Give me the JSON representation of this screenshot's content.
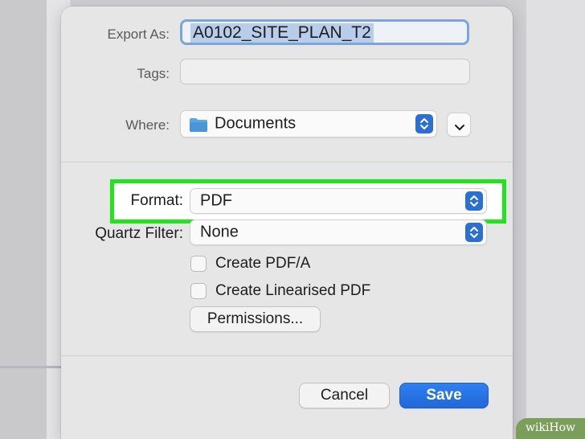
{
  "dialog": {
    "export_as_label": "Export As:",
    "export_as_value": "A0102_SITE_PLAN_T2",
    "tags_label": "Tags:",
    "tags_value": "",
    "where_label": "Where:",
    "where_value": "Documents",
    "where_icon": "folder-icon",
    "format_label": "Format:",
    "format_value": "PDF",
    "quartz_label": "Quartz Filter:",
    "quartz_value": "None",
    "create_pdfa_label": "Create PDF/A",
    "create_pdfa_checked": false,
    "create_linear_label": "Create Linearised PDF",
    "create_linear_checked": false,
    "permissions_label": "Permissions...",
    "cancel_label": "Cancel",
    "save_label": "Save"
  },
  "colors": {
    "highlight": "#1fe51a",
    "accent": "#2a6fd6"
  },
  "watermark": "wikiHow"
}
